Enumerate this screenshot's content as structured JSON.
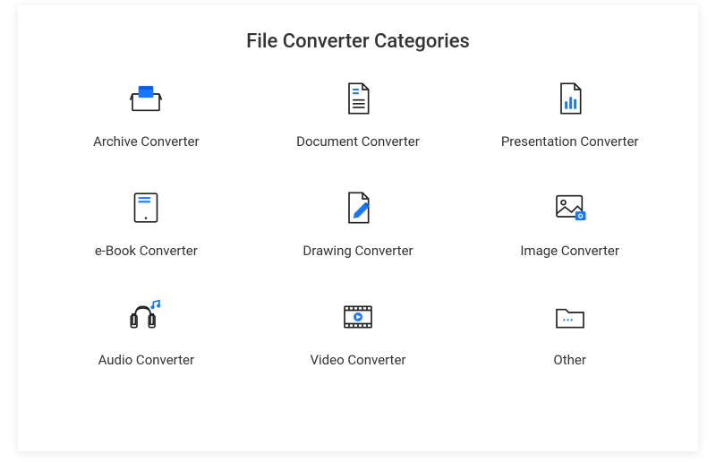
{
  "title": "File Converter Categories",
  "categories": [
    {
      "label": "Archive Converter",
      "icon": "archive-icon"
    },
    {
      "label": "Document Converter",
      "icon": "document-icon"
    },
    {
      "label": "Presentation Converter",
      "icon": "presentation-icon"
    },
    {
      "label": "e-Book Converter",
      "icon": "ebook-icon"
    },
    {
      "label": "Drawing Converter",
      "icon": "drawing-icon"
    },
    {
      "label": "Image Converter",
      "icon": "image-icon"
    },
    {
      "label": "Audio Converter",
      "icon": "audio-icon"
    },
    {
      "label": "Video Converter",
      "icon": "video-icon"
    },
    {
      "label": "Other",
      "icon": "folder-icon"
    }
  ],
  "colors": {
    "accent": "#1976ff",
    "stroke": "#222"
  }
}
